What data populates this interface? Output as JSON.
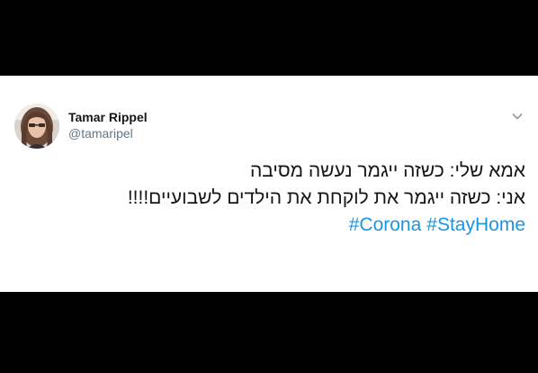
{
  "tweet": {
    "author": {
      "display_name": "Tamar Rippel",
      "handle": "@tamaripel"
    },
    "lines": [
      "אמא שלי: כשזה ייגמר נעשה מסיבה",
      "אני: כשזה ייגמר את לוקחת את הילדים לשבועיים!!!!"
    ],
    "hashtags": [
      "#Corona",
      "#StayHome"
    ]
  },
  "icons": {
    "menu": "chevron-down-icon",
    "avatar": "profile-photo"
  },
  "colors": {
    "background": "#000000",
    "card": "#ffffff",
    "text": "#14171a",
    "secondary_text": "#657786",
    "link": "#1b95e0"
  }
}
